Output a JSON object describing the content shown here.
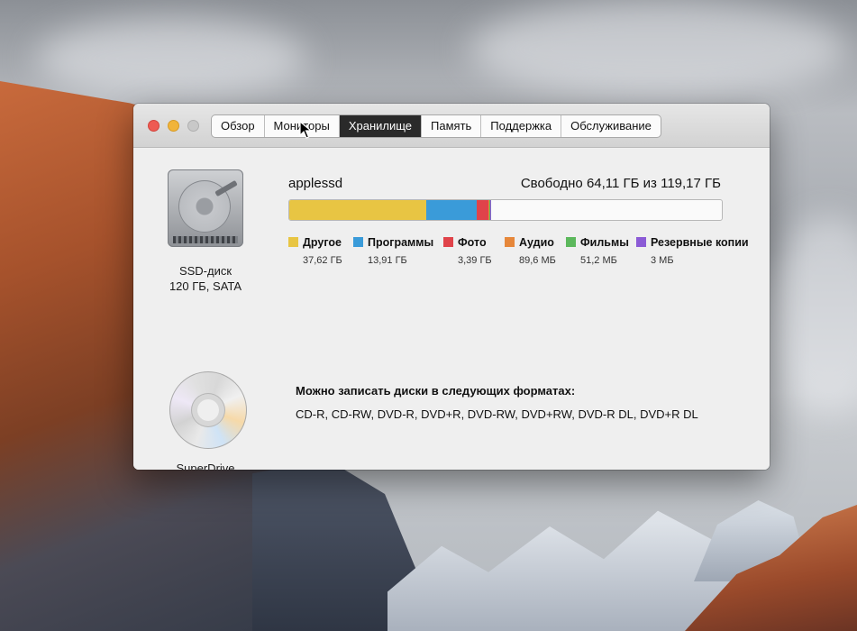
{
  "window": {
    "tabs": [
      "Обзор",
      "Мониторы",
      "Хранилище",
      "Память",
      "Поддержка",
      "Обслуживание"
    ],
    "selected_tab": "Хранилище"
  },
  "disks": [
    {
      "icon": "hard-drive-icon",
      "line1": "SSD-диск",
      "line2": "120 ГБ, SATA"
    },
    {
      "icon": "optical-disc-icon",
      "line1": "SuperDrive"
    }
  ],
  "storage": {
    "volume_name": "applessd",
    "free_text": "Свободно 64,11 ГБ из 119,17 ГБ",
    "total_gb": 119.17,
    "categories": [
      {
        "name": "Другое",
        "size": "37,62 ГБ",
        "gb": 37.62,
        "color": "#e8c543"
      },
      {
        "name": "Программы",
        "size": "13,91 ГБ",
        "gb": 13.91,
        "color": "#3a9bd9"
      },
      {
        "name": "Фото",
        "size": "3,39 ГБ",
        "gb": 3.39,
        "color": "#e0434a"
      },
      {
        "name": "Аудио",
        "size": "89,6 МБ",
        "gb": 0.0896,
        "color": "#e6873a"
      },
      {
        "name": "Фильмы",
        "size": "51,2 МБ",
        "gb": 0.0512,
        "color": "#5cb85c"
      },
      {
        "name": "Резервные копии",
        "size": "3 МБ",
        "gb": 0.003,
        "color": "#8b5bd6"
      }
    ]
  },
  "burn": {
    "title": "Можно записать диски в следующих форматах:",
    "formats": "CD-R, CD-RW, DVD-R, DVD+R, DVD-RW, DVD+RW, DVD-R DL, DVD+R DL"
  }
}
